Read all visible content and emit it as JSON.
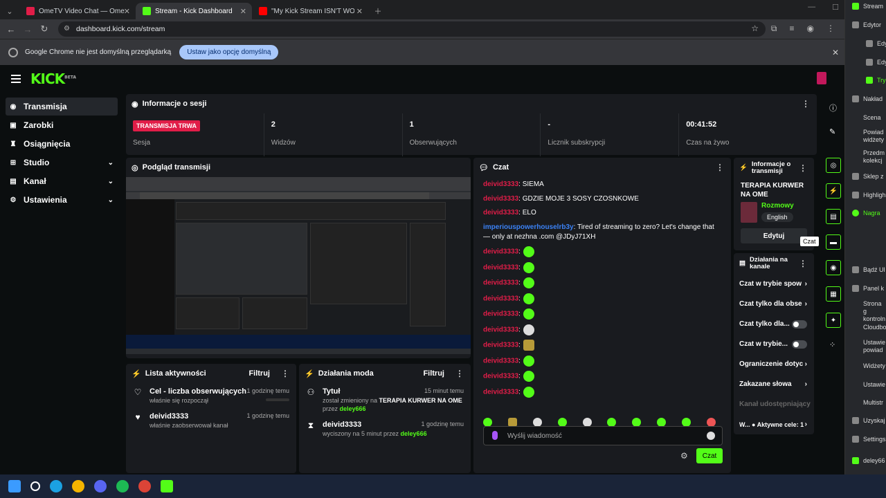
{
  "browser": {
    "tabs": [
      {
        "title": "OmeTV Video Chat — Ome",
        "active": false,
        "color": "#e11d48"
      },
      {
        "title": "Stream - Kick Dashboard",
        "active": true,
        "color": "#53fc18"
      },
      {
        "title": "\"My Kick Stream ISN'T WORKIN",
        "active": false,
        "color": "#ff0000"
      }
    ],
    "url": "dashboard.kick.com/stream",
    "infobar_text": "Google Chrome nie jest domyślną przeglądarką",
    "infobar_button": "Ustaw jako opcję domyślną"
  },
  "app": {
    "logo": "KICK",
    "logo_beta": "BETA"
  },
  "sidebar": {
    "items": [
      {
        "label": "Transmisja",
        "icon": "broadcast-icon",
        "active": true,
        "expandable": false
      },
      {
        "label": "Zarobki",
        "icon": "wallet-icon",
        "active": false,
        "expandable": false
      },
      {
        "label": "Osiągnięcia",
        "icon": "trophy-icon",
        "active": false,
        "expandable": false
      },
      {
        "label": "Studio",
        "icon": "studio-icon",
        "active": false,
        "expandable": true
      },
      {
        "label": "Kanał",
        "icon": "channel-icon",
        "active": false,
        "expandable": true
      },
      {
        "label": "Ustawienia",
        "icon": "gear-icon",
        "active": false,
        "expandable": true
      }
    ]
  },
  "session": {
    "title": "Informacje o sesji",
    "live_badge": "TRANSMISJA TRWA",
    "stats": [
      {
        "value": "",
        "label": "Sesja"
      },
      {
        "value": "2",
        "label": "Widzów"
      },
      {
        "value": "1",
        "label": "Obserwujących"
      },
      {
        "value": "-",
        "label": "Licznik subskrypcji"
      },
      {
        "value": "00:41:52",
        "label": "Czas na żywo"
      }
    ]
  },
  "preview": {
    "title": "Podgląd transmisji"
  },
  "activity": {
    "title": "Lista aktywności",
    "filter": "Filtruj",
    "items": [
      {
        "title": "Cel - liczba obserwujących",
        "subtitle": "właśnie się rozpoczął",
        "time": "1 godzinę temu"
      },
      {
        "title": "deivid3333",
        "subtitle": "właśnie zaobserwował kanał",
        "time": "1 godzinę temu"
      }
    ]
  },
  "mod": {
    "title": "Działania moda",
    "filter": "Filtruj",
    "items": [
      {
        "title": "Tytuł",
        "line1_pre": "został zmieniony na ",
        "line1_bold": "TERAPIA KURWER NA OME",
        "line2_pre": "przez ",
        "line2_user": "deley666",
        "time": "15 minut temu"
      },
      {
        "title": "deivid3333",
        "line1_pre": "wyciszony na 5 minut przez ",
        "line1_bold": "",
        "line2_pre": "",
        "line2_user": "deley666",
        "time": "1 godzinę temu"
      }
    ]
  },
  "chat": {
    "title": "Czat",
    "messages": [
      {
        "user": "deivid3333",
        "text": ": SIEMA",
        "emote": ""
      },
      {
        "user": "deivid3333",
        "text": ": GDZIE MOJE 3 SOSY CZOSNKOWE",
        "emote": ""
      },
      {
        "user": "deivid3333",
        "text": ": ELO",
        "emote": ""
      },
      {
        "user": "imperiouspowerhouselrb3y",
        "text": ": Tired of streaming to zero? Let's change that — only at nezhna .com @JDyJ71XH",
        "emote": "",
        "spam": true
      },
      {
        "user": "deivid3333",
        "text": ":",
        "emote": "green"
      },
      {
        "user": "deivid3333",
        "text": ":",
        "emote": "green"
      },
      {
        "user": "deivid3333",
        "text": ":",
        "emote": "green"
      },
      {
        "user": "deivid3333",
        "text": ":",
        "emote": "green"
      },
      {
        "user": "deivid3333",
        "text": ":",
        "emote": "green"
      },
      {
        "user": "deivid3333",
        "text": ":",
        "emote": "bw"
      },
      {
        "user": "deivid3333",
        "text": ":",
        "emote": "yl"
      },
      {
        "user": "deivid3333",
        "text": ":",
        "emote": "green"
      },
      {
        "user": "deivid3333",
        "text": ":",
        "emote": "green"
      },
      {
        "user": "deivid3333",
        "text": ":",
        "emote": "green"
      }
    ],
    "input_placeholder": "Wyślij wiadomość",
    "send_label": "Czat"
  },
  "stream_info": {
    "title": "Informacje o transmisji",
    "stream_title": "TERAPIA KURWER NA OME",
    "category": "Rozmowy",
    "language": "English",
    "edit_label": "Edytuj"
  },
  "channel_actions": {
    "title": "Działania na kanale",
    "items": [
      {
        "label": "Czat w trybie spow",
        "control": "chevron"
      },
      {
        "label": "Czat tylko dla obse",
        "control": "chevron"
      },
      {
        "label": "Czat tylko dla...",
        "control": "toggle"
      },
      {
        "label": "Czat w trybie...",
        "control": "toggle"
      },
      {
        "label": "Ograniczenie dotyc",
        "control": "chevron"
      },
      {
        "label": "Zakazane słowa",
        "control": "chevron"
      },
      {
        "label": "Kanał udostępniający",
        "control": "none",
        "muted": true
      },
      {
        "label": "W... ● Aktywne cele: 1",
        "control": "chevron"
      }
    ]
  },
  "right_tooltip": "Czat",
  "obs_panel": {
    "items": [
      "Stream",
      "Edytor",
      "Edyt",
      "Edyt",
      "Tryb",
      "Nakład",
      "Scena",
      "Powiad widżety",
      "Przedm kolekcj",
      "Sklep z",
      "Highligh",
      "Nagra",
      "Bądź Ul",
      "Panel k",
      "Strona g kontroln",
      "Cloudbo",
      "Ustawie powiad",
      "Widżety",
      "Ustawie",
      "Multistr",
      "Uzyskaj",
      "Settings",
      "deley66"
    ]
  },
  "colors": {
    "accent": "#53fc18",
    "live": "#e11d48",
    "panel": "#191b1f"
  }
}
